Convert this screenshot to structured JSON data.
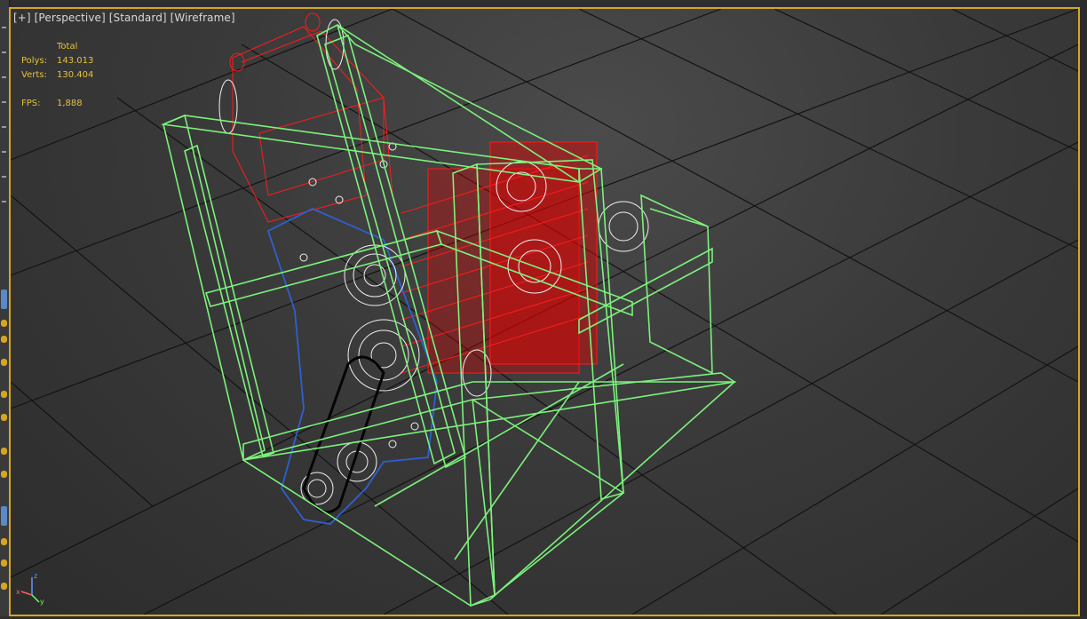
{
  "viewport": {
    "label_parts": [
      "[+]",
      "[Perspective]",
      "[Standard]",
      "[Wireframe]"
    ],
    "stats": {
      "header": "Total",
      "polys_label": "Polys:",
      "polys_value": "143.013",
      "verts_label": "Verts:",
      "verts_value": "130.404",
      "fps_label": "FPS:",
      "fps_value": "1,888"
    },
    "gizmo": {
      "x_label": "x",
      "y_label": "y",
      "z_label": "z"
    }
  },
  "colors": {
    "viewport_border": "#d6a81c",
    "frame_wire": "#7cf27c",
    "red_assembly": "#ff1a1a",
    "blue_plate": "#2f5fd0",
    "white_parts": "#f0f0f0",
    "grid": "#111111",
    "stats_text": "#e6c23a"
  }
}
